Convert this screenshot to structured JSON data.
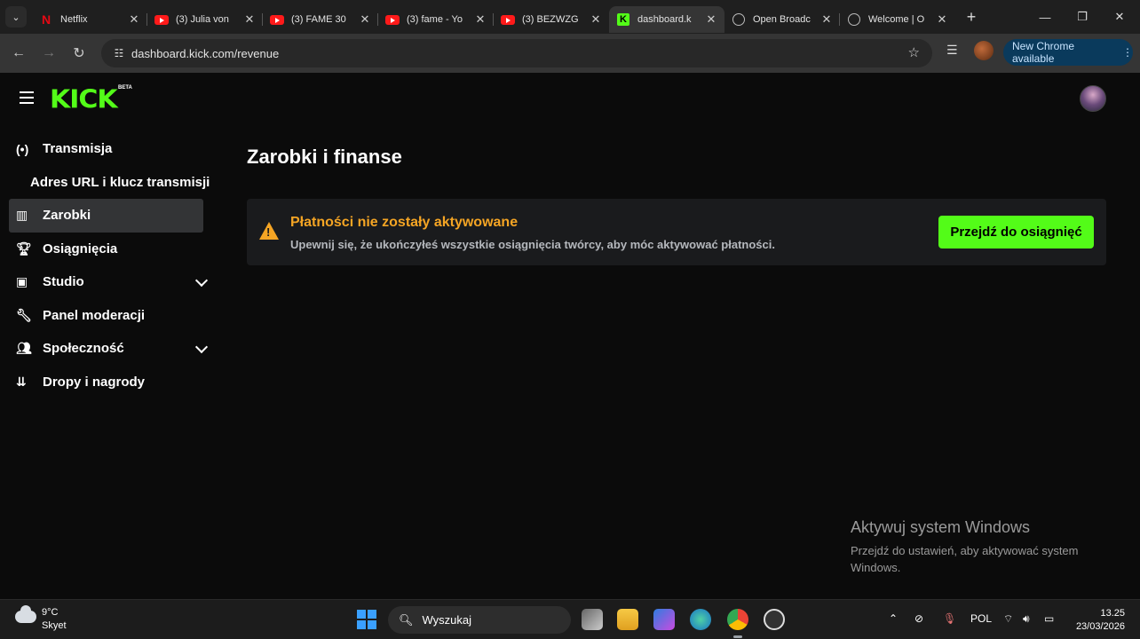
{
  "browser": {
    "tabs": [
      {
        "title": "Netflix",
        "icon": "netflix-icon"
      },
      {
        "title": "(3) Julia von",
        "icon": "youtube-icon"
      },
      {
        "title": "(3) FAME 30",
        "icon": "youtube-icon"
      },
      {
        "title": "(3) fame - Yo",
        "icon": "youtube-icon"
      },
      {
        "title": "(3) BEZWZG",
        "icon": "youtube-icon"
      },
      {
        "title": "dashboard.k",
        "icon": "kick-icon",
        "active": true
      },
      {
        "title": "Open Broadc",
        "icon": "obs-icon"
      },
      {
        "title": "Welcome | O",
        "icon": "globe-icon"
      }
    ],
    "url": "dashboard.kick.com/revenue",
    "update_pill": "New Chrome available"
  },
  "app": {
    "logo": "KICK",
    "logo_badge": "BETA",
    "accent": "#53fc18"
  },
  "sidebar": {
    "items": [
      {
        "label": "Transmisja",
        "icon": "broadcast-icon"
      },
      {
        "label": "Adres URL i klucz transmisji",
        "sub": true
      },
      {
        "label": "Zarobki",
        "icon": "chart-icon",
        "active": true
      },
      {
        "label": "Osiągnięcia",
        "icon": "trophy-icon"
      },
      {
        "label": "Studio",
        "icon": "studio-icon",
        "expandable": true
      },
      {
        "label": "Panel moderacji",
        "icon": "wrench-icon"
      },
      {
        "label": "Społeczność",
        "icon": "users-icon",
        "expandable": true
      },
      {
        "label": "Dropy i nagrody",
        "icon": "drops-icon"
      }
    ]
  },
  "main": {
    "title": "Zarobki i finanse",
    "alert": {
      "title": "Płatności nie zostały aktywowane",
      "description": "Upewnij się, że ukończyłeś wszystkie osiągnięcia twórcy, aby móc aktywować płatności.",
      "button": "Przejdź do osiągnięć",
      "warning_color": "#f5a524"
    }
  },
  "watermark": {
    "title": "Aktywuj system Windows",
    "text": "Przejdź do ustawień, aby aktywować system Windows."
  },
  "taskbar": {
    "weather_temp": "9°C",
    "weather_desc": "Skyet",
    "search_placeholder": "Wyszukaj",
    "language": "POL",
    "time": "13.25",
    "date": "23/03/2026"
  }
}
